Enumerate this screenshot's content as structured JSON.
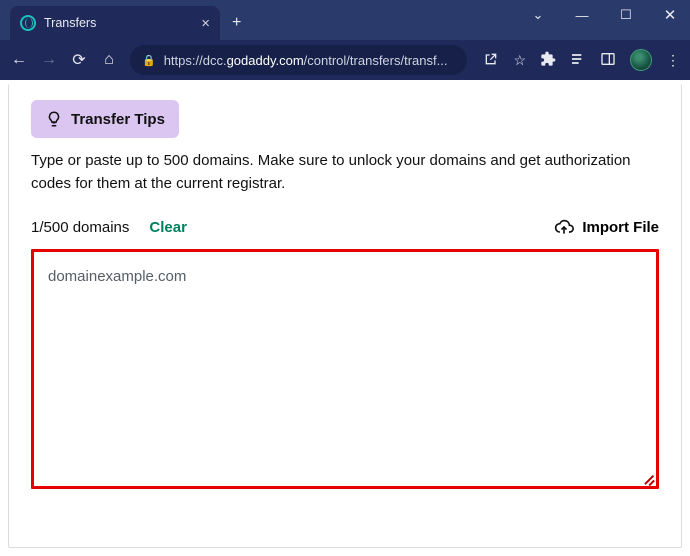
{
  "browser": {
    "tab_title": "Transfers",
    "url_scheme": "https://",
    "url_sub": "dcc.",
    "url_host": "godaddy.com",
    "url_path": "/control/transfers/transf..."
  },
  "page": {
    "tip_label": "Transfer Tips",
    "instructions": "Type or paste up to 500 domains. Make sure to unlock your domains and get authorization codes for them at the current registrar.",
    "count_label": "1/500 domains",
    "clear_label": "Clear",
    "import_label": "Import File",
    "textarea_value": "domainexample.com"
  }
}
